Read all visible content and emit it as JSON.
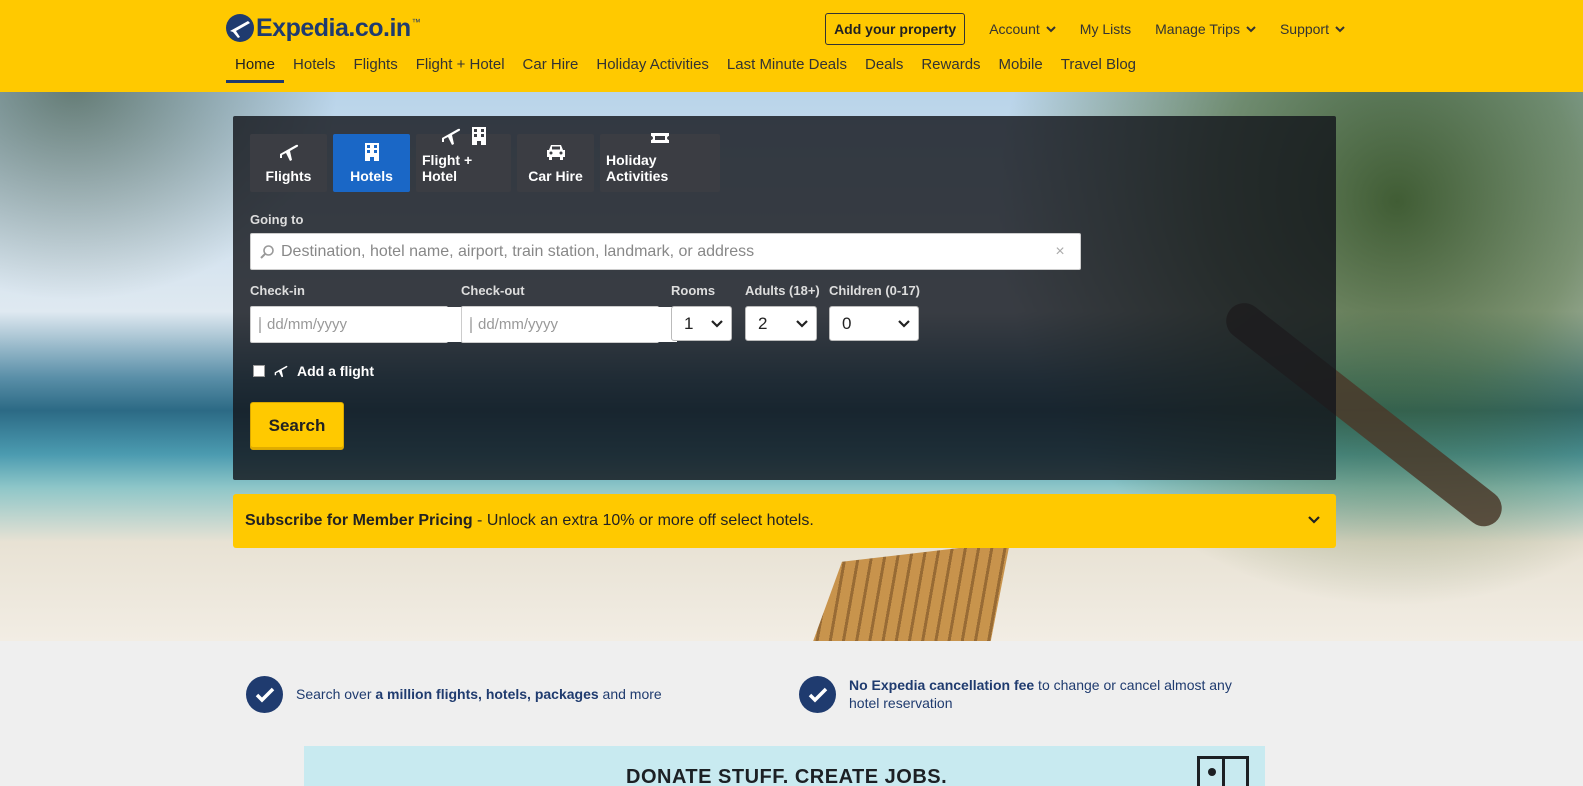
{
  "header": {
    "logo_text": "Expedia.co.in",
    "logo_tm": "™",
    "add_property": "Add your property",
    "account": "Account",
    "my_lists": "My Lists",
    "manage_trips": "Manage Trips",
    "support": "Support"
  },
  "nav": {
    "items": [
      "Home",
      "Hotels",
      "Flights",
      "Flight + Hotel",
      "Car Hire",
      "Holiday Activities",
      "Last Minute Deals",
      "Deals",
      "Rewards",
      "Mobile",
      "Travel Blog"
    ],
    "active": "Home"
  },
  "search": {
    "tabs": [
      "Flights",
      "Hotels",
      "Flight + Hotel",
      "Car Hire",
      "Holiday Activities"
    ],
    "active_tab": "Hotels",
    "going_to_label": "Going to",
    "going_to_placeholder": "Destination, hotel name, airport, train station, landmark, or address",
    "checkin_label": "Check-in",
    "checkin_placeholder": "dd/mm/yyyy",
    "checkout_label": "Check-out",
    "checkout_placeholder": "dd/mm/yyyy",
    "rooms_label": "Rooms",
    "rooms_value": "1",
    "adults_label": "Adults (18+)",
    "adults_value": "2",
    "children_label": "Children (0-17)",
    "children_value": "0",
    "add_flight_label": "Add a flight",
    "search_button": "Search"
  },
  "member": {
    "bold": "Subscribe for Member Pricing",
    "rest": " - Unlock an extra 10% or more off select hotels."
  },
  "benefits": [
    {
      "pre": "Search over ",
      "bold": "a million flights, hotels, packages",
      "post": " and more"
    },
    {
      "pre": "",
      "bold": "No Expedia cancellation fee",
      "post": " to change or cancel almost any hotel reservation"
    }
  ],
  "banner": {
    "text": "DONATE STUFF. CREATE JOBS."
  },
  "colors": {
    "brand_yellow": "#ffc900",
    "brand_navy": "#1f3b6f",
    "tab_active": "#1a67c6"
  }
}
